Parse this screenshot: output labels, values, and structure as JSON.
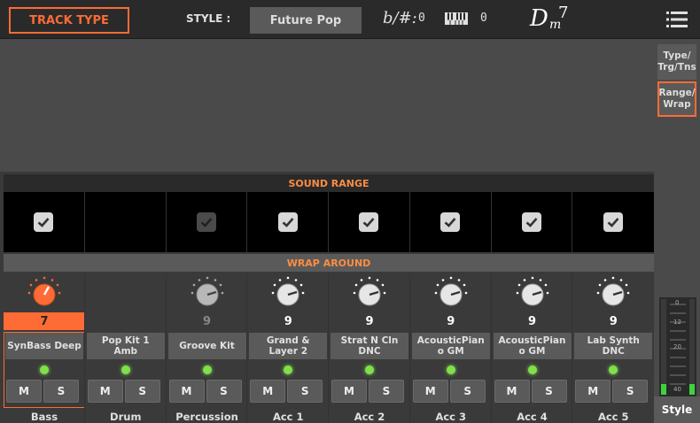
{
  "topbar": {
    "track_type_label": "TRACK TYPE",
    "style_label": "STYLE :",
    "style_name": "Future Pop",
    "transpose_symbol": "b/#:",
    "transpose_value": "0",
    "octave_value": "0",
    "chord_root": "D",
    "chord_quality": "m",
    "chord_extension": "7"
  },
  "side_tabs": {
    "type_label": "Type/ Trg/Tns",
    "range_label": "Range/ Wrap",
    "style_label": "Style"
  },
  "meter": {
    "ticks": [
      "0",
      "12",
      "20",
      "40"
    ]
  },
  "sound_range": {
    "title": "SOUND RANGE",
    "checked": [
      true,
      null,
      "disabled",
      true,
      true,
      true,
      true,
      true
    ]
  },
  "wrap_around": {
    "title": "WRAP AROUND"
  },
  "tracks": [
    {
      "wrap": "7",
      "sound": "SynBass Deep",
      "label": "Bass",
      "knob": "active"
    },
    {
      "wrap": "",
      "sound": "Pop Kit 1 Amb",
      "label": "Drum",
      "knob": "none"
    },
    {
      "wrap": "9",
      "sound": "Groove Kit",
      "label": "Percussion",
      "knob": "dim"
    },
    {
      "wrap": "9",
      "sound": "Grand & Layer 2",
      "label": "Acc 1",
      "knob": "normal"
    },
    {
      "wrap": "9",
      "sound": "Strat N Cln DNC",
      "label": "Acc 2",
      "knob": "normal"
    },
    {
      "wrap": "9",
      "sound": "AcousticPian o GM",
      "label": "Acc 3",
      "knob": "normal"
    },
    {
      "wrap": "9",
      "sound": "AcousticPian o GM",
      "label": "Acc 4",
      "knob": "normal"
    },
    {
      "wrap": "9",
      "sound": "Lab Synth DNC",
      "label": "Acc 5",
      "knob": "normal"
    }
  ],
  "mute_label": "M",
  "solo_label": "S",
  "colors": {
    "accent": "#ff6b35",
    "led": "#7fe04a"
  }
}
